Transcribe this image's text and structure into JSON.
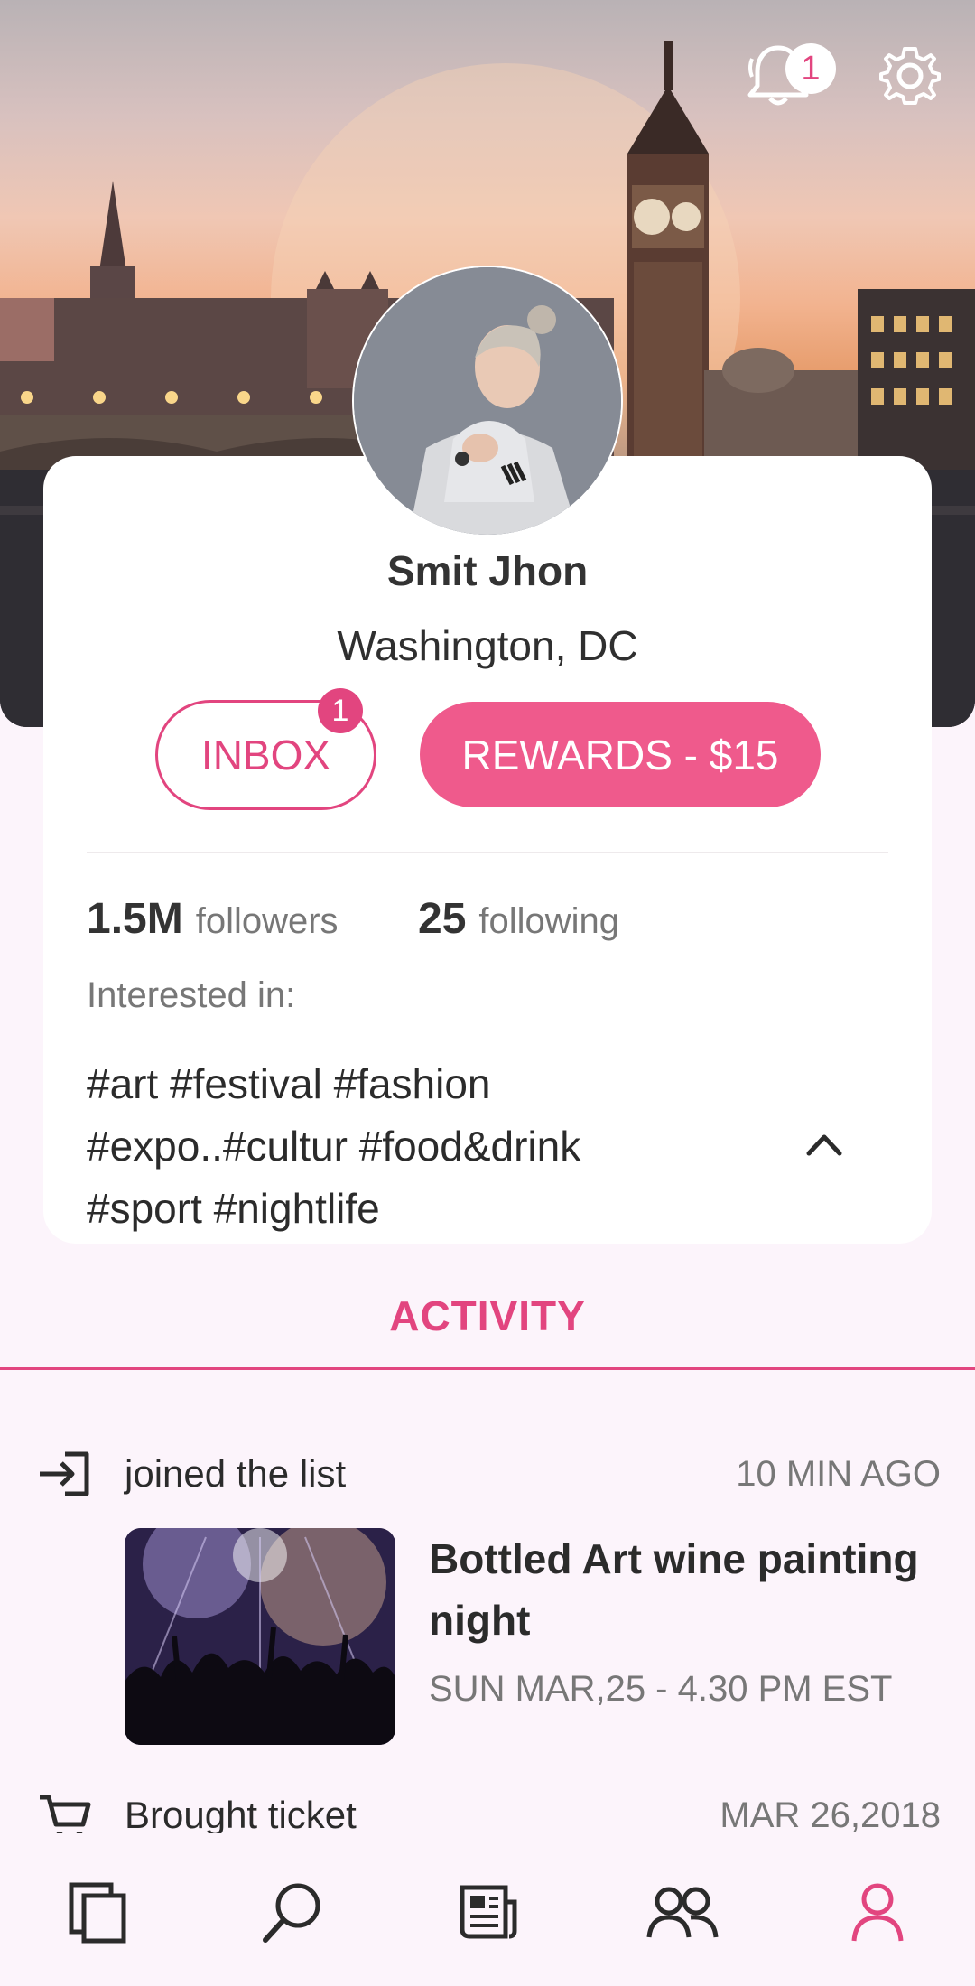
{
  "header": {
    "notification_count": "1",
    "icons": [
      "bell-icon",
      "gear-icon"
    ]
  },
  "profile": {
    "name": "Smit Jhon",
    "location": "Washington, DC",
    "inbox_label": "INBOX",
    "inbox_badge": "1",
    "rewards_label": "REWARDS - $15",
    "followers_count": "1.5M",
    "followers_label": "followers",
    "following_count": "25",
    "following_label": "following",
    "interested_label": "Interested in:",
    "tags_lines": [
      "#art #festival #fashion",
      "#expo..#cultur #food&drink",
      "#sport #nightlife"
    ]
  },
  "activity": {
    "tab_label": "ACTIVITY",
    "items": [
      {
        "action": "joined the list",
        "time": "10 MIN AGO",
        "icon": "login-icon",
        "event_title": "Bottled Art wine painting night",
        "event_date": "SUN MAR,25 - 4.30 PM EST"
      },
      {
        "action": "Brought ticket",
        "time": "MAR 26,2018",
        "icon": "cart-icon"
      }
    ]
  },
  "nav": {
    "items": [
      "pages-icon",
      "search-icon",
      "news-icon",
      "people-icon",
      "profile-icon"
    ],
    "active": "profile-icon"
  },
  "colors": {
    "accent": "#e2457f",
    "rewards": "#ef5a8c",
    "background": "#fcf4fb"
  }
}
